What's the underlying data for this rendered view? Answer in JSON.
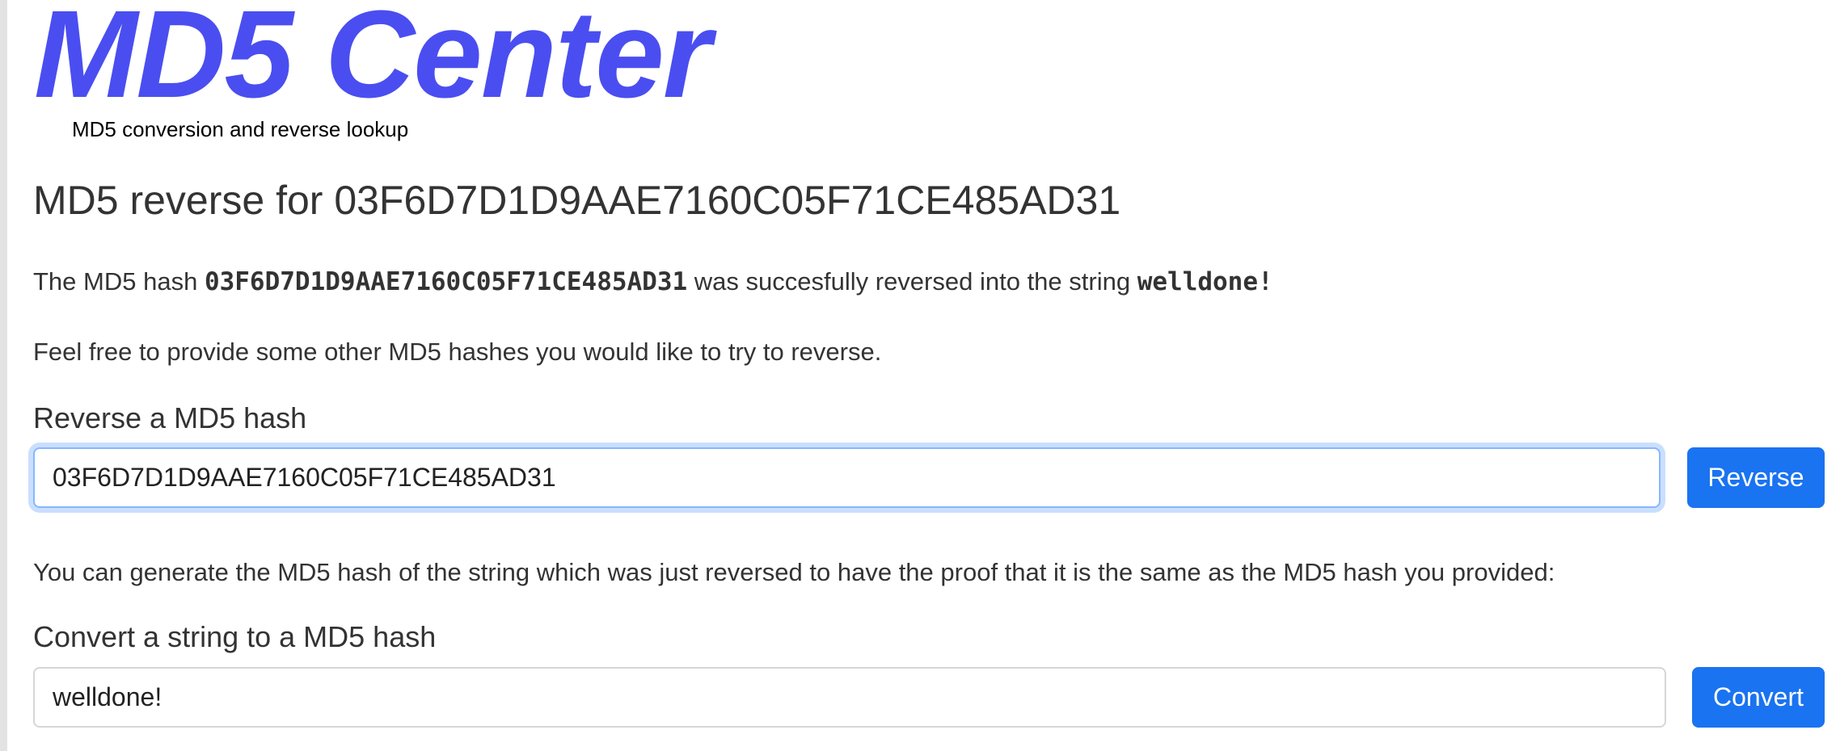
{
  "site": {
    "logo": "MD5 Center",
    "tagline": "MD5 conversion and reverse lookup"
  },
  "page": {
    "title": "MD5 reverse for 03F6D7D1D9AAE7160C05F71CE485AD31"
  },
  "result": {
    "prefix": "The MD5 hash ",
    "hash": "03F6D7D1D9AAE7160C05F71CE485AD31",
    "middle": " was succesfully reversed into the string ",
    "string": "welldone!"
  },
  "invite_text": "Feel free to provide some other MD5 hashes you would like to try to reverse.",
  "reverse_form": {
    "label": "Reverse a MD5 hash",
    "value": "03F6D7D1D9AAE7160C05F71CE485AD31",
    "button": "Reverse"
  },
  "proof_text": "You can generate the MD5 hash of the string which was just reversed to have the proof that it is the same as the MD5 hash you provided:",
  "convert_form": {
    "label": "Convert a string to a MD5 hash",
    "value": "welldone!",
    "button": "Convert"
  },
  "colors": {
    "logo": "#4a4ef0",
    "button": "#1a73f0",
    "focus_ring": "#86b7fe"
  }
}
